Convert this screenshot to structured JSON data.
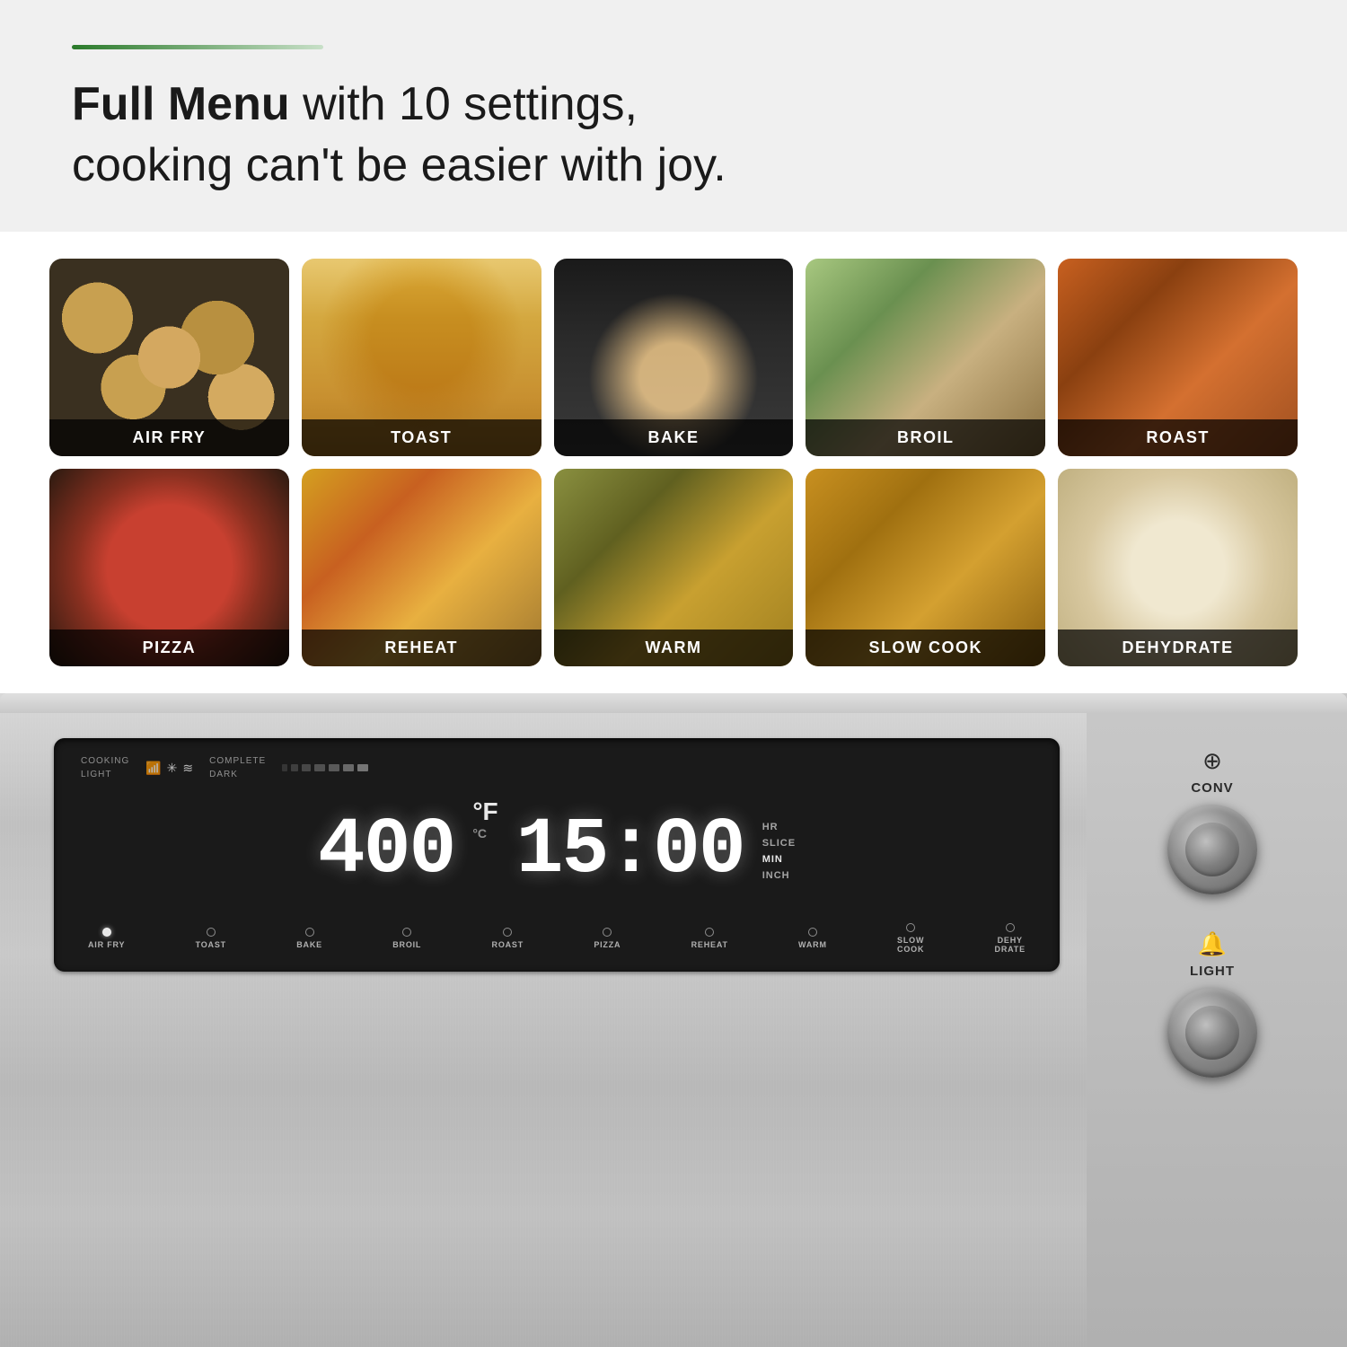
{
  "header": {
    "accent_bar_alt": "green gradient bar",
    "title_bold": "Full Menu",
    "title_rest": " with 10 settings,\ncooking can't be easier with joy."
  },
  "food_grid": {
    "items": [
      {
        "id": "air-fry",
        "label": "AIR FRY",
        "css_class": "food-air-fry"
      },
      {
        "id": "toast",
        "label": "TOAST",
        "css_class": "food-toast"
      },
      {
        "id": "bake",
        "label": "BAKE",
        "css_class": "food-bake"
      },
      {
        "id": "broil",
        "label": "BROIL",
        "css_class": "food-broil"
      },
      {
        "id": "roast",
        "label": "ROAST",
        "css_class": "food-roast"
      },
      {
        "id": "pizza",
        "label": "PIZZA",
        "css_class": "food-pizza"
      },
      {
        "id": "reheat",
        "label": "REHEAT",
        "css_class": "food-reheat"
      },
      {
        "id": "warm",
        "label": "WARM",
        "css_class": "food-warm"
      },
      {
        "id": "slow-cook",
        "label": "SLOW COOK",
        "css_class": "food-slow-cook"
      },
      {
        "id": "dehydrate",
        "label": "DEHYDRATE",
        "css_class": "food-dehydrate"
      }
    ]
  },
  "display": {
    "label_cooking": "COOKING",
    "label_light": "LIGHT",
    "label_complete": "COMPLETE",
    "label_dark": "DARK",
    "temperature": "400",
    "temp_unit_f": "°F",
    "temp_unit_c": "°C",
    "time": "15:00",
    "time_unit_hr": "HR",
    "time_unit_slice": "SLICE",
    "time_unit_min": "MIN",
    "time_unit_inch": "INCH",
    "mode_buttons": [
      {
        "id": "air-fry",
        "label": "AIR FRY",
        "active": true
      },
      {
        "id": "toast",
        "label": "TOAST",
        "active": false
      },
      {
        "id": "bake",
        "label": "BAKE",
        "active": false
      },
      {
        "id": "broil",
        "label": "BROIL",
        "active": false
      },
      {
        "id": "roast",
        "label": "ROAST",
        "active": false
      },
      {
        "id": "pizza",
        "label": "PIZZA",
        "active": false
      },
      {
        "id": "reheat",
        "label": "REHEAT",
        "active": false
      },
      {
        "id": "warm",
        "label": "WARM",
        "active": false
      },
      {
        "id": "slow-cook",
        "label": "SLOW\nCOOK",
        "active": false
      },
      {
        "id": "dehydrate",
        "label": "DEHY\nDRATE",
        "active": false
      }
    ]
  },
  "controls": {
    "conv_label": "CONV",
    "light_label": "LIGHT"
  }
}
